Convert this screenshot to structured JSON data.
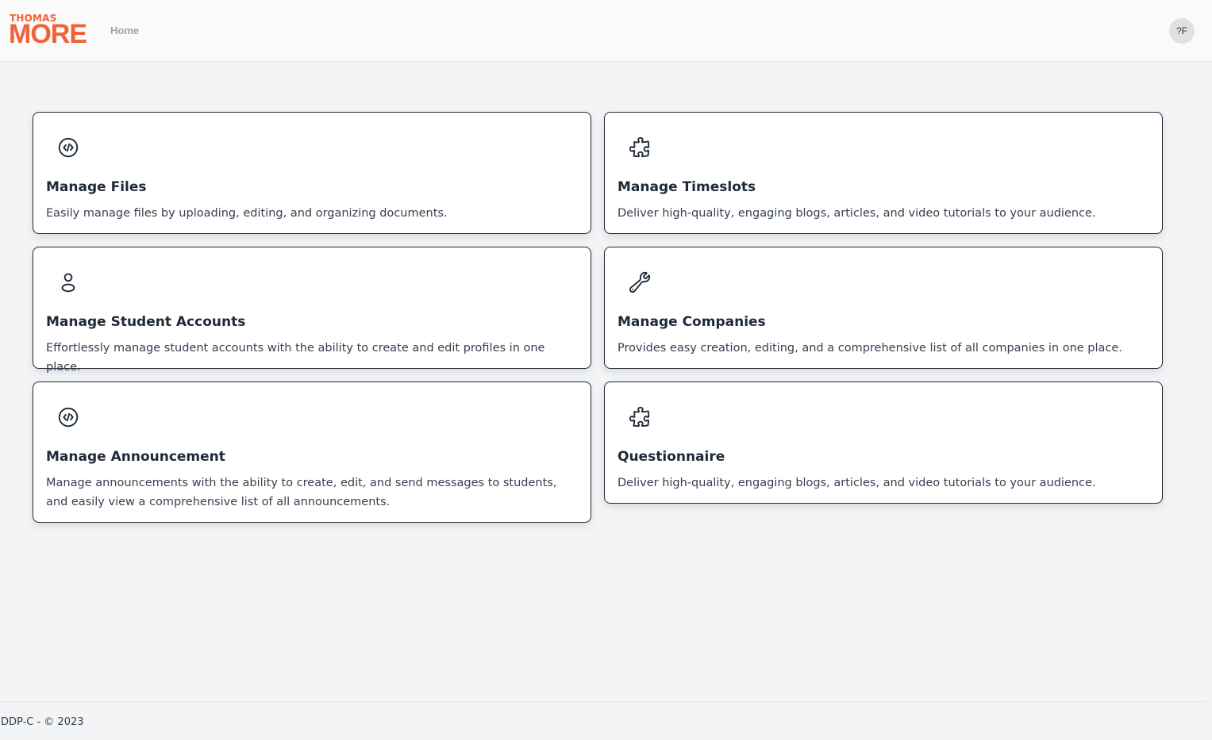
{
  "header": {
    "logo_top": "THOMAS",
    "logo_bottom": "MORE",
    "nav_home": "Home",
    "avatar_initials": "?F",
    "brand_color": "#f0633a"
  },
  "cards": [
    {
      "title": "Manage Files",
      "description": "Easily manage files by uploading, editing, and organizing documents.",
      "icon": "code-circle-icon"
    },
    {
      "title": "Manage Timeslots",
      "description": "Deliver high-quality, engaging blogs, articles, and video tutorials to your audience.",
      "icon": "puzzle-icon"
    },
    {
      "title": "Manage Student Accounts",
      "description": "Effortlessly manage student accounts with the ability to create and edit profiles in one place.",
      "icon": "user-icon"
    },
    {
      "title": "Manage Companies",
      "description": "Provides easy creation, editing, and a comprehensive list of all companies in one place.",
      "icon": "wrench-icon"
    },
    {
      "title": "Manage Announcement",
      "description": "Manage announcements with the ability to create, edit, and send messages to students, and easily view a comprehensive list of all announcements.",
      "icon": "code-circle-icon"
    },
    {
      "title": "Questionnaire",
      "description": "Deliver high-quality, engaging blogs, articles, and video tutorials to your audience.",
      "icon": "puzzle-icon"
    }
  ],
  "footer": {
    "text": "DDP-C - © 2023"
  }
}
